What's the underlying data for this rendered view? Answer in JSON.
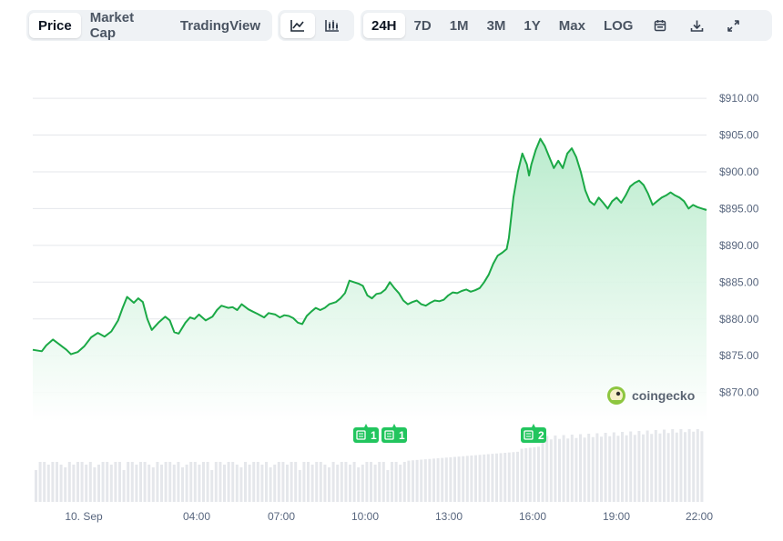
{
  "toolbar": {
    "view_tabs": [
      "Price",
      "Market Cap",
      "TradingView"
    ],
    "active_view": "Price",
    "chart_styles": [
      {
        "name": "line",
        "icon": "line-chart-icon",
        "active": true
      },
      {
        "name": "candle",
        "icon": "candlestick-icon",
        "active": false
      }
    ],
    "ranges": [
      "24H",
      "7D",
      "1M",
      "3M",
      "1Y",
      "Max",
      "LOG"
    ],
    "active_range": "24H",
    "tools": [
      {
        "icon": "calendar-icon"
      },
      {
        "icon": "download-icon"
      },
      {
        "icon": "expand-icon"
      }
    ]
  },
  "watermark": "coingecko",
  "chart_data": {
    "type": "area",
    "x_tick_labels": [
      "10. Sep",
      "04:00",
      "07:00",
      "10:00",
      "13:00",
      "16:00",
      "19:00",
      "22:00"
    ],
    "y_tick_labels": [
      "$910.00",
      "$905.00",
      "$900.00",
      "$895.00",
      "$890.00",
      "$885.00",
      "$880.00",
      "$875.00",
      "$870.00"
    ],
    "ylim": [
      866,
      911
    ],
    "xlim_hours": [
      0,
      24
    ],
    "series": [
      {
        "values": [
          [
            0.0,
            875.8
          ],
          [
            0.4,
            875.6
          ],
          [
            0.6,
            876.4
          ],
          [
            0.9,
            877.2
          ],
          [
            1.2,
            876.5
          ],
          [
            1.5,
            875.8
          ],
          [
            1.7,
            875.2
          ],
          [
            2.0,
            875.5
          ],
          [
            2.3,
            876.3
          ],
          [
            2.6,
            877.5
          ],
          [
            2.9,
            878.1
          ],
          [
            3.2,
            877.6
          ],
          [
            3.5,
            878.3
          ],
          [
            3.8,
            879.8
          ],
          [
            4.0,
            881.5
          ],
          [
            4.2,
            883.0
          ],
          [
            4.5,
            882.2
          ],
          [
            4.7,
            882.8
          ],
          [
            4.9,
            882.3
          ],
          [
            5.1,
            880.0
          ],
          [
            5.3,
            878.5
          ],
          [
            5.6,
            879.5
          ],
          [
            5.9,
            880.3
          ],
          [
            6.1,
            879.8
          ],
          [
            6.3,
            878.2
          ],
          [
            6.5,
            878.0
          ],
          [
            6.8,
            879.5
          ],
          [
            7.0,
            880.2
          ],
          [
            7.2,
            880.0
          ],
          [
            7.4,
            880.6
          ],
          [
            7.7,
            879.8
          ],
          [
            8.0,
            880.3
          ],
          [
            8.2,
            881.2
          ],
          [
            8.4,
            881.8
          ],
          [
            8.7,
            881.5
          ],
          [
            8.9,
            881.6
          ],
          [
            9.1,
            881.2
          ],
          [
            9.3,
            882.0
          ],
          [
            9.6,
            881.3
          ],
          [
            9.8,
            881.0
          ],
          [
            10.0,
            880.7
          ],
          [
            10.3,
            880.2
          ],
          [
            10.5,
            880.8
          ],
          [
            10.8,
            880.6
          ],
          [
            11.0,
            880.2
          ],
          [
            11.2,
            880.5
          ],
          [
            11.4,
            880.4
          ],
          [
            11.6,
            880.1
          ],
          [
            11.8,
            879.5
          ],
          [
            12.0,
            879.3
          ],
          [
            12.2,
            880.4
          ],
          [
            12.4,
            881.0
          ],
          [
            12.6,
            881.5
          ],
          [
            12.8,
            881.2
          ],
          [
            13.0,
            881.5
          ],
          [
            13.2,
            882.0
          ],
          [
            13.5,
            882.3
          ],
          [
            13.7,
            882.8
          ],
          [
            13.9,
            883.5
          ],
          [
            14.1,
            885.2
          ],
          [
            14.3,
            885.0
          ],
          [
            14.5,
            884.8
          ],
          [
            14.7,
            884.5
          ],
          [
            14.9,
            883.2
          ],
          [
            15.1,
            882.8
          ],
          [
            15.3,
            883.4
          ],
          [
            15.5,
            883.5
          ],
          [
            15.7,
            884.0
          ],
          [
            15.9,
            885.0
          ],
          [
            16.1,
            884.2
          ],
          [
            16.3,
            883.5
          ],
          [
            16.5,
            882.5
          ],
          [
            16.7,
            882.0
          ],
          [
            16.9,
            882.3
          ],
          [
            17.1,
            882.5
          ],
          [
            17.3,
            882.0
          ],
          [
            17.5,
            881.8
          ],
          [
            17.7,
            882.2
          ],
          [
            17.9,
            882.5
          ],
          [
            18.1,
            882.4
          ],
          [
            18.3,
            882.6
          ],
          [
            18.5,
            883.2
          ],
          [
            18.7,
            883.6
          ],
          [
            18.9,
            883.5
          ],
          [
            19.1,
            883.8
          ],
          [
            19.3,
            884.0
          ],
          [
            19.5,
            883.7
          ],
          [
            19.7,
            883.9
          ],
          [
            19.9,
            884.2
          ],
          [
            20.1,
            885.0
          ],
          [
            20.3,
            886.0
          ],
          [
            20.5,
            887.5
          ],
          [
            20.7,
            888.6
          ],
          [
            20.9,
            889.0
          ],
          [
            21.1,
            889.5
          ],
          [
            21.2,
            891.0
          ],
          [
            21.4,
            896.5
          ],
          [
            21.6,
            900.0
          ],
          [
            21.8,
            902.5
          ],
          [
            22.0,
            901.0
          ],
          [
            22.1,
            899.5
          ],
          [
            22.2,
            901.0
          ],
          [
            22.4,
            903.0
          ],
          [
            22.6,
            904.5
          ],
          [
            22.8,
            903.5
          ],
          [
            23.0,
            902.0
          ],
          [
            23.2,
            900.5
          ],
          [
            23.4,
            901.5
          ],
          [
            23.6,
            900.5
          ],
          [
            23.8,
            902.5
          ],
          [
            24.0,
            903.2
          ],
          [
            24.2,
            902.0
          ],
          [
            24.4,
            900.0
          ],
          [
            24.6,
            897.5
          ],
          [
            24.8,
            896.0
          ],
          [
            25.0,
            895.5
          ],
          [
            25.2,
            896.5
          ],
          [
            25.4,
            895.8
          ],
          [
            25.6,
            895.0
          ],
          [
            25.8,
            896.0
          ],
          [
            26.0,
            896.5
          ],
          [
            26.2,
            895.8
          ],
          [
            26.4,
            896.8
          ],
          [
            26.6,
            898.0
          ],
          [
            26.8,
            898.5
          ],
          [
            27.0,
            898.8
          ],
          [
            27.2,
            898.2
          ],
          [
            27.4,
            897.0
          ],
          [
            27.6,
            895.5
          ],
          [
            27.8,
            896.0
          ],
          [
            28.0,
            896.5
          ],
          [
            28.2,
            896.8
          ],
          [
            28.4,
            897.2
          ],
          [
            28.6,
            896.8
          ],
          [
            28.8,
            896.5
          ],
          [
            29.0,
            896.0
          ],
          [
            29.2,
            895.0
          ],
          [
            29.4,
            895.5
          ],
          [
            29.6,
            895.2
          ],
          [
            29.8,
            895.0
          ],
          [
            30.0,
            894.8
          ]
        ]
      }
    ],
    "event_markers": [
      {
        "label": "1",
        "time": "10:00"
      },
      {
        "label": "1",
        "time": "11:00"
      },
      {
        "label": "2",
        "time": "16:00"
      }
    ],
    "volume_note": "volume bars, unlabeled",
    "grid": true,
    "colors": {
      "line": "#16c784",
      "line_dark": "#1ba946",
      "fill_top": "#b7ebcb",
      "fill_bottom": "#ffffff",
      "grid": "#e5e7eb",
      "volume": "#e5e7eb",
      "marker": "#22c55e",
      "axis_text": "#58667e"
    }
  }
}
